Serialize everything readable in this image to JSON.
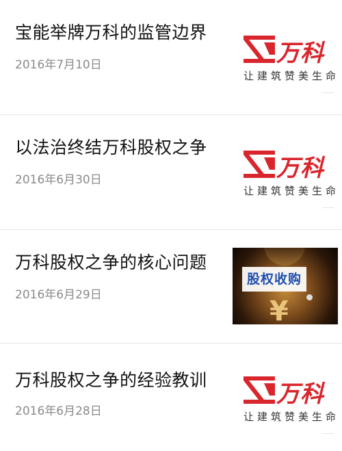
{
  "articles": [
    {
      "title": "宝能举牌万科的监管边界",
      "date": "2016年7月10日",
      "thumbnail": {
        "type": "vanke-logo",
        "brand": "万科",
        "slogan": "让建筑赞美生命",
        "brand_color": "#d9262d"
      }
    },
    {
      "title": "以法治终结万科股权之争",
      "date": "2016年6月30日",
      "thumbnail": {
        "type": "vanke-logo",
        "brand": "万科",
        "slogan": "让建筑赞美生命",
        "brand_color": "#d9262d"
      }
    },
    {
      "title": "万科股权之争的核心问题",
      "date": "2016年6月29日",
      "thumbnail": {
        "type": "money-bag",
        "label": "股权收购",
        "symbol": "¥",
        "label_color": "#1f4fb0"
      }
    },
    {
      "title": "万科股权之争的经验教训",
      "date": "2016年6月28日",
      "thumbnail": {
        "type": "vanke-logo",
        "brand": "万科",
        "slogan": "让建筑赞美生命",
        "brand_color": "#d9262d"
      }
    }
  ],
  "colors": {
    "title": "#111111",
    "date": "#8a8a8a",
    "divider": "#e6e6e6"
  }
}
